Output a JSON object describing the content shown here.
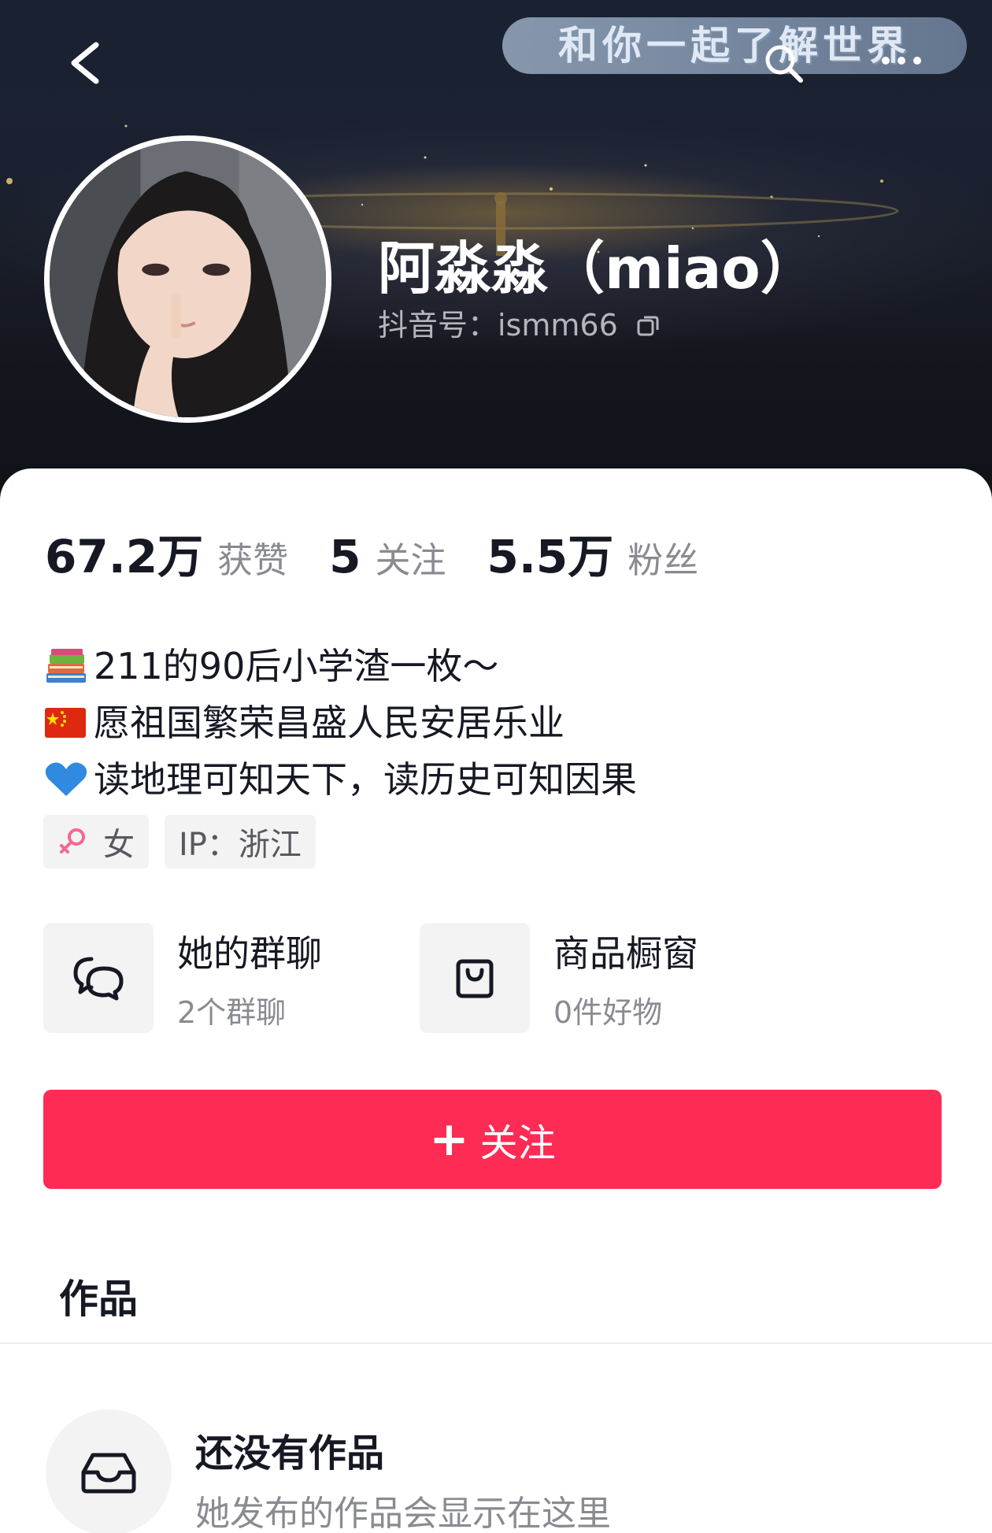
{
  "header": {
    "banner_text": "和你一起了解世界",
    "nickname": "阿淼淼（miao）",
    "douyin_id": "抖音号：ismm66"
  },
  "stats": [
    {
      "number": "67.2万",
      "label": "获赞"
    },
    {
      "number": "5",
      "label": "关注"
    },
    {
      "number": "5.5万",
      "label": "粉丝"
    }
  ],
  "bio": [
    {
      "emoji": "books-icon",
      "text": "211的90后小学渣一枚～"
    },
    {
      "emoji": "china-flag-icon",
      "text": "愿祖国繁荣昌盛人民安居乐业"
    },
    {
      "emoji": "blue-heart-icon",
      "text": "读地理可知天下，读历史可知因果"
    }
  ],
  "tags": {
    "gender": "女",
    "ip": "IP：浙江"
  },
  "entries": {
    "group_chat": {
      "title": "她的群聊",
      "subtitle": "2个群聊"
    },
    "showcase": {
      "title": "商品橱窗",
      "subtitle": "0件好物"
    }
  },
  "follow_button": {
    "label": "关注"
  },
  "works": {
    "tab_label": "作品",
    "empty_title": "还没有作品",
    "empty_subtitle": "她发布的作品会显示在这里"
  },
  "colors": {
    "accent": "#fe2c55",
    "header_bg": "#1a2232",
    "secondary_text": "#8a8b91"
  }
}
